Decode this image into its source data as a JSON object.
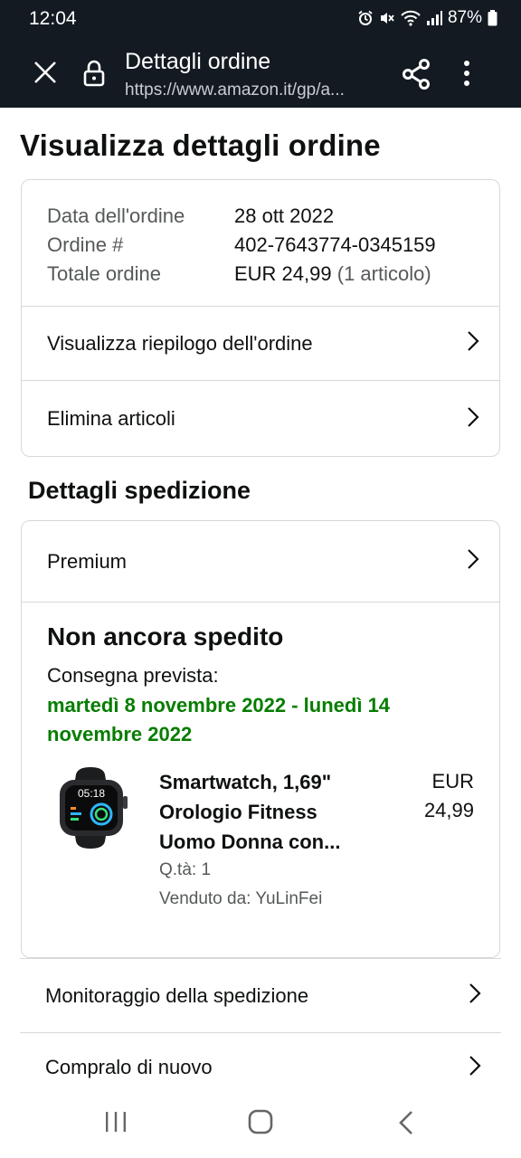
{
  "status_bar": {
    "time": "12:04",
    "battery": "87%",
    "icons": [
      "alarm-icon",
      "mute-icon",
      "wifi-icon",
      "signal-icon",
      "battery-icon"
    ]
  },
  "browser": {
    "page_title": "Dettagli ordine",
    "url": "https://www.amazon.it/gp/a...",
    "icons": [
      "close-icon",
      "lock-icon",
      "share-icon",
      "more-icon"
    ]
  },
  "page": {
    "title": "Visualizza dettagli ordine"
  },
  "order_summary": {
    "rows": [
      {
        "label": "Data dell'ordine",
        "value": "28 ott 2022"
      },
      {
        "label": "Ordine #",
        "value": "402-7643774-0345159"
      },
      {
        "label": "Totale ordine",
        "value": "EUR 24,99",
        "extra": "(1 articolo)"
      }
    ],
    "links": [
      {
        "label": "Visualizza riepilogo dell'ordine"
      },
      {
        "label": "Elimina articoli"
      }
    ]
  },
  "shipment": {
    "section_title": "Dettagli spedizione",
    "method": "Premium",
    "status": "Non ancora spedito",
    "eta_label": "Consegna prevista:",
    "eta_date": "martedì 8 novembre 2022 - lunedì 14 novembre 2022",
    "product": {
      "title": "Smartwatch, 1,69\" Orologio Fitness Uomo Donna con...",
      "currency": "EUR",
      "price": "24,99",
      "quantity": "Q.tà: 1",
      "seller": "Venduto da: YuLinFei",
      "watch_time": "05:18"
    }
  },
  "bottom_links": [
    {
      "label": "Monitoraggio della spedizione"
    },
    {
      "label": "Compralo di nuovo"
    }
  ],
  "colors": {
    "header_bg": "#131a22",
    "delivery_green": "#067d00",
    "border": "#d5d9d9",
    "muted_text": "#565959"
  }
}
